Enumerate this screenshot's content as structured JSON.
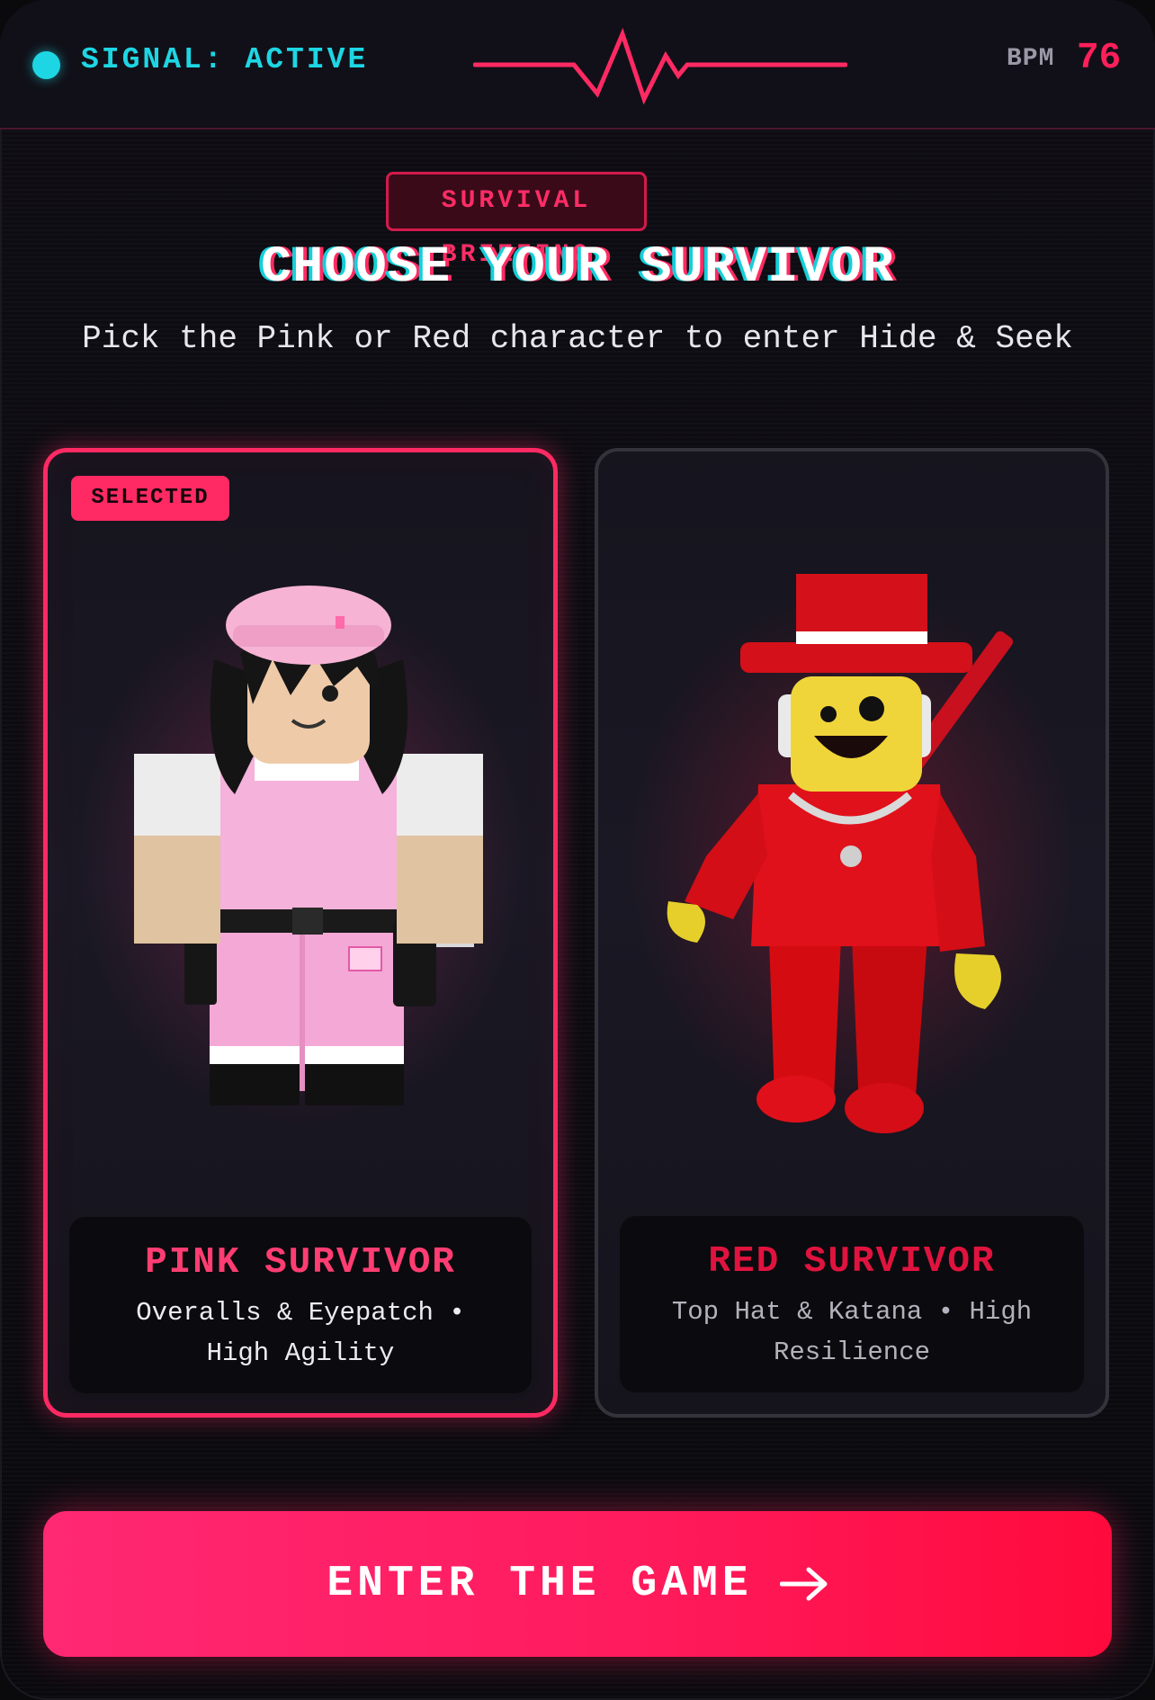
{
  "status": {
    "signal_label": "SIGNAL: ACTIVE",
    "bpm_label": "BPM",
    "bpm_value": "76"
  },
  "header": {
    "badge": "SURVIVAL BRIEFING",
    "title": "CHOOSE YOUR SURVIVOR",
    "subtitle": "Pick the Pink or Red character to enter Hide & Seek"
  },
  "cards": [
    {
      "selected_badge": "SELECTED",
      "name": "PINK SURVIVOR",
      "description": "Overalls & Eyepatch • High Agility",
      "selected": true
    },
    {
      "name": "RED SURVIVOR",
      "description": "Top Hat & Katana • High Resilience",
      "selected": false
    }
  ],
  "cta": {
    "label": "ENTER THE GAME",
    "icon": "arrow-right-icon"
  },
  "colors": {
    "accent": "#ff2a63",
    "signal": "#1ed6e3",
    "red_name": "#e0133f",
    "background": "#0c0b11"
  }
}
